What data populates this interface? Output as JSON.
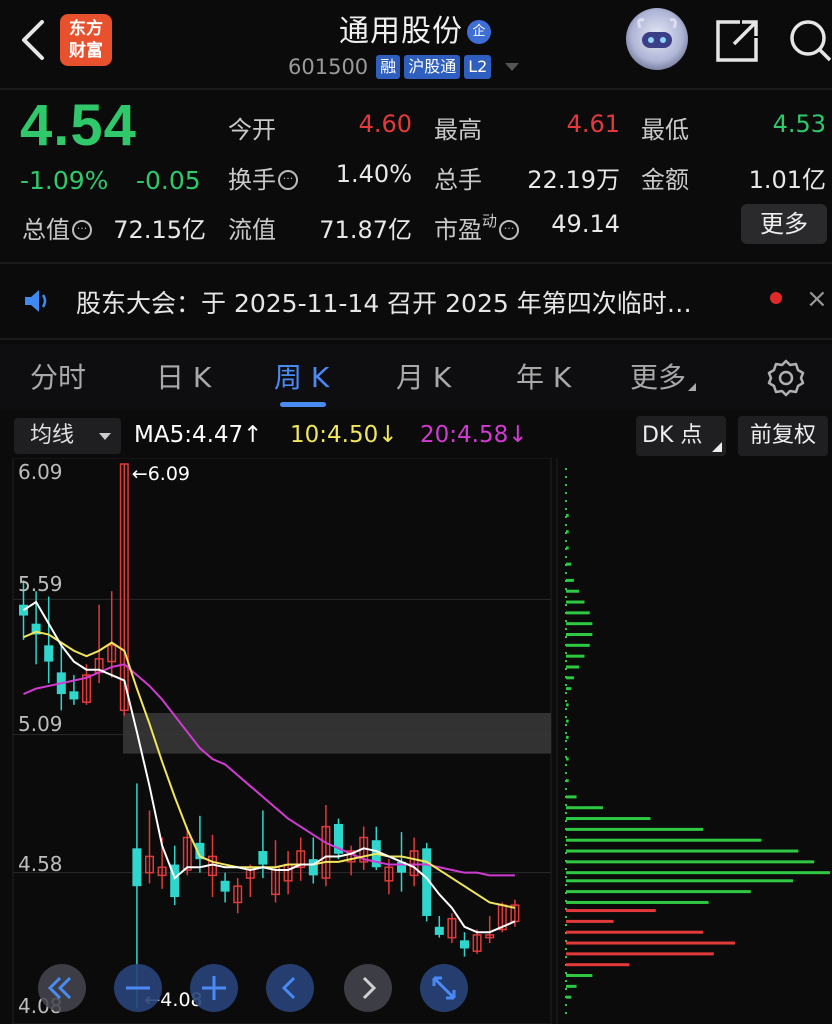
{
  "header": {
    "logo_line1": "东方",
    "logo_line2": "财富",
    "stock_name": "通用股份",
    "name_badge": "企",
    "code": "601500",
    "tags": [
      "融",
      "沪股通",
      "L2"
    ]
  },
  "quote": {
    "price": "4.54",
    "pct_change": "-1.09%",
    "change": "-0.05",
    "fields": [
      {
        "label": "今开",
        "value": "4.60",
        "color": "#e23a3a"
      },
      {
        "label": "最高",
        "value": "4.61",
        "color": "#e23a3a"
      },
      {
        "label": "最低",
        "value": "4.53",
        "color": "#2fc86b"
      },
      {
        "label": "换手",
        "value": "1.40%",
        "color": "#e8e8e8"
      },
      {
        "label": "总手",
        "value": "22.19万",
        "color": "#e8e8e8"
      },
      {
        "label": "金额",
        "value": "1.01亿",
        "color": "#e8e8e8"
      },
      {
        "label": "总值",
        "value": "72.15亿",
        "color": "#e8e8e8"
      },
      {
        "label": "流值",
        "value": "71.87亿",
        "color": "#e8e8e8"
      },
      {
        "label": "市盈",
        "value": "49.14",
        "color": "#e8e8e8"
      }
    ],
    "pe_sup": "动",
    "more_label": "更多"
  },
  "notice": {
    "text": "股东大会：于 2025-11-14 召开 2025 年第四次临时…",
    "close": "×"
  },
  "tabs": [
    {
      "label": "分时"
    },
    {
      "label": "日 K"
    },
    {
      "label": "周 K",
      "active": true
    },
    {
      "label": "月 K"
    },
    {
      "label": "年 K"
    },
    {
      "label": "更多"
    }
  ],
  "indicator": {
    "select_label": "均线",
    "ma5": "MA5:4.47↑",
    "ma10": "10:4.50↓",
    "ma20": "20:4.58↓",
    "dk_label": "DK 点",
    "adjust_label": "前复权"
  },
  "colors": {
    "up": "#e23a3a",
    "down": "#2fd6cc",
    "ma5": "#ffffff",
    "ma10": "#f2e65a",
    "ma20": "#d23bd2",
    "profile_sell": "#2fc842",
    "profile_buy": "#e23a3a"
  },
  "chart_data": {
    "type": "candlestick",
    "title": "",
    "y_ticks": [
      "6.09",
      "5.59",
      "5.09",
      "4.58",
      "4.08"
    ],
    "ylim": [
      4.08,
      6.09
    ],
    "max_label": "←6.09",
    "min_label": "←4.08",
    "candles": [
      {
        "o": 5.57,
        "h": 5.66,
        "l": 5.44,
        "c": 5.53
      },
      {
        "o": 5.5,
        "h": 5.62,
        "l": 5.35,
        "c": 5.46
      },
      {
        "o": 5.42,
        "h": 5.6,
        "l": 5.28,
        "c": 5.36
      },
      {
        "o": 5.32,
        "h": 5.42,
        "l": 5.18,
        "c": 5.24
      },
      {
        "o": 5.25,
        "h": 5.31,
        "l": 5.2,
        "c": 5.22
      },
      {
        "o": 5.21,
        "h": 5.35,
        "l": 5.2,
        "c": 5.31
      },
      {
        "o": 5.32,
        "h": 5.57,
        "l": 5.28,
        "c": 5.37
      },
      {
        "o": 5.36,
        "h": 5.62,
        "l": 5.3,
        "c": 5.42
      },
      {
        "o": 5.18,
        "h": 6.09,
        "l": 5.16,
        "c": 6.09
      },
      {
        "o": 4.67,
        "h": 4.91,
        "l": 4.08,
        "c": 4.53
      },
      {
        "o": 4.58,
        "h": 4.81,
        "l": 4.54,
        "c": 4.64
      },
      {
        "o": 4.57,
        "h": 4.71,
        "l": 4.52,
        "c": 4.6
      },
      {
        "o": 4.61,
        "h": 4.68,
        "l": 4.46,
        "c": 4.49
      },
      {
        "o": 4.59,
        "h": 4.75,
        "l": 4.57,
        "c": 4.71
      },
      {
        "o": 4.69,
        "h": 4.79,
        "l": 4.58,
        "c": 4.63
      },
      {
        "o": 4.57,
        "h": 4.72,
        "l": 4.49,
        "c": 4.64
      },
      {
        "o": 4.55,
        "h": 4.58,
        "l": 4.47,
        "c": 4.51
      },
      {
        "o": 4.47,
        "h": 4.56,
        "l": 4.43,
        "c": 4.53
      },
      {
        "o": 4.56,
        "h": 4.61,
        "l": 4.49,
        "c": 4.6
      },
      {
        "o": 4.66,
        "h": 4.81,
        "l": 4.56,
        "c": 4.61
      },
      {
        "o": 4.5,
        "h": 4.7,
        "l": 4.47,
        "c": 4.6
      },
      {
        "o": 4.55,
        "h": 4.66,
        "l": 4.5,
        "c": 4.61
      },
      {
        "o": 4.6,
        "h": 4.71,
        "l": 4.55,
        "c": 4.66
      },
      {
        "o": 4.63,
        "h": 4.71,
        "l": 4.54,
        "c": 4.57
      },
      {
        "o": 4.56,
        "h": 4.83,
        "l": 4.53,
        "c": 4.75
      },
      {
        "o": 4.76,
        "h": 4.78,
        "l": 4.63,
        "c": 4.65
      },
      {
        "o": 4.62,
        "h": 4.68,
        "l": 4.57,
        "c": 4.66
      },
      {
        "o": 4.62,
        "h": 4.75,
        "l": 4.59,
        "c": 4.71
      },
      {
        "o": 4.7,
        "h": 4.75,
        "l": 4.59,
        "c": 4.6
      },
      {
        "o": 4.55,
        "h": 4.63,
        "l": 4.5,
        "c": 4.6
      },
      {
        "o": 4.62,
        "h": 4.73,
        "l": 4.51,
        "c": 4.58
      },
      {
        "o": 4.57,
        "h": 4.71,
        "l": 4.53,
        "c": 4.66
      },
      {
        "o": 4.67,
        "h": 4.69,
        "l": 4.4,
        "c": 4.42
      },
      {
        "o": 4.38,
        "h": 4.42,
        "l": 4.34,
        "c": 4.35
      },
      {
        "o": 4.34,
        "h": 4.43,
        "l": 4.32,
        "c": 4.41
      },
      {
        "o": 4.33,
        "h": 4.36,
        "l": 4.27,
        "c": 4.3
      },
      {
        "o": 4.29,
        "h": 4.37,
        "l": 4.28,
        "c": 4.35
      },
      {
        "o": 4.34,
        "h": 4.42,
        "l": 4.32,
        "c": 4.35
      },
      {
        "o": 4.37,
        "h": 4.47,
        "l": 4.36,
        "c": 4.46
      },
      {
        "o": 4.4,
        "h": 4.48,
        "l": 4.38,
        "c": 4.46
      }
    ],
    "ma5": [
      5.55,
      5.58,
      5.5,
      5.42,
      5.36,
      5.33,
      5.33,
      5.31,
      5.29,
      5.1,
      4.9,
      4.68,
      4.56,
      4.6,
      4.6,
      4.61,
      4.6,
      4.6,
      4.59,
      4.6,
      4.59,
      4.59,
      4.61,
      4.61,
      4.64,
      4.64,
      4.65,
      4.67,
      4.66,
      4.64,
      4.62,
      4.6,
      4.56,
      4.5,
      4.45,
      4.38,
      4.36,
      4.36,
      4.38,
      4.4
    ],
    "ma10": [
      5.45,
      5.47,
      5.46,
      5.43,
      5.4,
      5.38,
      5.4,
      5.43,
      5.4,
      5.26,
      5.13,
      4.99,
      4.86,
      4.74,
      4.64,
      4.62,
      4.61,
      4.6,
      4.6,
      4.6,
      4.6,
      4.61,
      4.61,
      4.61,
      4.62,
      4.62,
      4.63,
      4.64,
      4.65,
      4.64,
      4.64,
      4.63,
      4.62,
      4.59,
      4.56,
      4.53,
      4.5,
      4.47,
      4.46,
      4.45
    ],
    "ma20": [
      5.24,
      5.26,
      5.27,
      5.28,
      5.29,
      5.3,
      5.32,
      5.34,
      5.35,
      5.31,
      5.27,
      5.22,
      5.16,
      5.1,
      5.04,
      5.0,
      4.98,
      4.94,
      4.9,
      4.86,
      4.82,
      4.78,
      4.75,
      4.72,
      4.69,
      4.67,
      4.65,
      4.63,
      4.62,
      4.61,
      4.61,
      4.61,
      4.61,
      4.6,
      4.59,
      4.58,
      4.58,
      4.57,
      4.57,
      4.57
    ],
    "pressure_zone": [
      5.02,
      5.17
    ],
    "volume_profile": [
      {
        "price": 5.9,
        "w": 0.01,
        "side": "sell"
      },
      {
        "price": 5.84,
        "w": 0.01,
        "side": "sell"
      },
      {
        "price": 5.78,
        "w": 0.01,
        "side": "sell"
      },
      {
        "price": 5.72,
        "w": 0.02,
        "side": "sell"
      },
      {
        "price": 5.66,
        "w": 0.03,
        "side": "sell"
      },
      {
        "price": 5.62,
        "w": 0.05,
        "side": "sell"
      },
      {
        "price": 5.58,
        "w": 0.07,
        "side": "sell"
      },
      {
        "price": 5.54,
        "w": 0.09,
        "side": "sell"
      },
      {
        "price": 5.5,
        "w": 0.1,
        "side": "sell"
      },
      {
        "price": 5.46,
        "w": 0.1,
        "side": "sell"
      },
      {
        "price": 5.42,
        "w": 0.09,
        "side": "sell"
      },
      {
        "price": 5.38,
        "w": 0.07,
        "side": "sell"
      },
      {
        "price": 5.34,
        "w": 0.05,
        "side": "sell"
      },
      {
        "price": 5.3,
        "w": 0.03,
        "side": "sell"
      },
      {
        "price": 5.26,
        "w": 0.02,
        "side": "sell"
      },
      {
        "price": 5.2,
        "w": 0.01,
        "side": "sell"
      },
      {
        "price": 5.14,
        "w": 0.01,
        "side": "sell"
      },
      {
        "price": 5.08,
        "w": 0.01,
        "side": "sell"
      },
      {
        "price": 5.0,
        "w": 0.01,
        "side": "sell"
      },
      {
        "price": 4.92,
        "w": 0.01,
        "side": "sell"
      },
      {
        "price": 4.86,
        "w": 0.04,
        "side": "sell"
      },
      {
        "price": 4.82,
        "w": 0.14,
        "side": "sell"
      },
      {
        "price": 4.78,
        "w": 0.32,
        "side": "sell"
      },
      {
        "price": 4.74,
        "w": 0.52,
        "side": "sell"
      },
      {
        "price": 4.7,
        "w": 0.74,
        "side": "sell"
      },
      {
        "price": 4.66,
        "w": 0.88,
        "side": "sell"
      },
      {
        "price": 4.62,
        "w": 0.94,
        "side": "sell"
      },
      {
        "price": 4.58,
        "w": 1.0,
        "side": "sell"
      },
      {
        "price": 4.55,
        "w": 0.86,
        "side": "sell"
      },
      {
        "price": 4.51,
        "w": 0.7,
        "side": "sell"
      },
      {
        "price": 4.47,
        "w": 0.54,
        "side": "sell"
      },
      {
        "price": 4.44,
        "w": 0.34,
        "side": "buy"
      },
      {
        "price": 4.4,
        "w": 0.18,
        "side": "buy"
      },
      {
        "price": 4.36,
        "w": 0.52,
        "side": "buy"
      },
      {
        "price": 4.32,
        "w": 0.64,
        "side": "buy"
      },
      {
        "price": 4.28,
        "w": 0.56,
        "side": "buy"
      },
      {
        "price": 4.24,
        "w": 0.24,
        "side": "buy"
      },
      {
        "price": 4.2,
        "w": 0.1,
        "side": "sell"
      },
      {
        "price": 4.16,
        "w": 0.04,
        "side": "sell"
      },
      {
        "price": 4.12,
        "w": 0.02,
        "side": "sell"
      }
    ]
  },
  "controls": [
    "rewind-icon",
    "zoom-out-icon",
    "zoom-in-icon",
    "prev-icon",
    "next-icon",
    "fullscreen-icon"
  ]
}
